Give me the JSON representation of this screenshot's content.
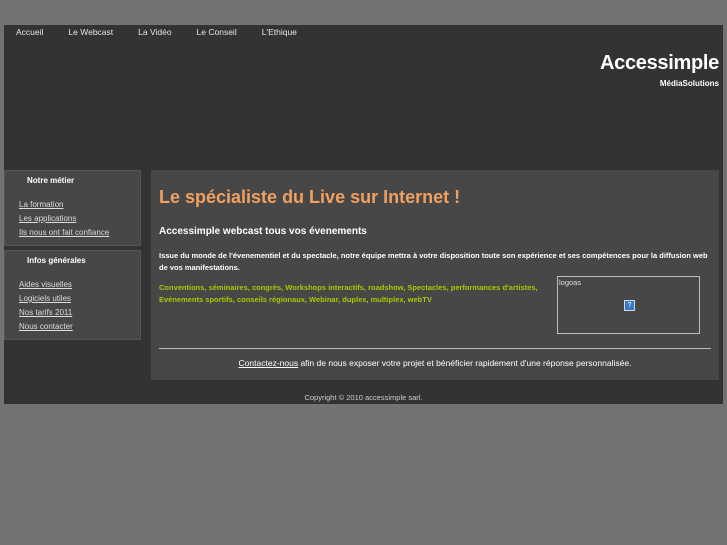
{
  "nav": [
    {
      "label": "Accueil"
    },
    {
      "label": "Le Webcast"
    },
    {
      "label": "La Vidéo"
    },
    {
      "label": "Le Conseil"
    },
    {
      "label": "L'Ethique"
    }
  ],
  "brand": {
    "title": "Accessimple",
    "subtitle": "MédiaSolutions"
  },
  "sidebar": {
    "sections": [
      {
        "title": "Notre métier",
        "items": [
          "La formation",
          "Les applications",
          "Ils nous ont fait confiance"
        ]
      },
      {
        "title": "Infos générales",
        "items": [
          "Aides visuelles",
          "Logiciels utiles",
          "Nos tarifs 2011",
          "Nous contacter"
        ]
      }
    ]
  },
  "main": {
    "headline": "Le spécialiste du Live sur Internet !",
    "subheadline": "Accessimple webcast tous vos évenements",
    "intro": "Issue du monde de l'évenementiel et du spectacle, notre équipe mettra à votre disposition toute son expérience et ses compétences pour la diffusion web de vos manifestations.",
    "events_line1": "Conventions, séminaires, congrès, Workshops interactifs, roadshow, Spectacles, performances d'artistes,",
    "events_line2": "Evénements sportifs, conseils régionaux, Webinar, duplex, multiplex, webTV",
    "logos_label": "logoas",
    "contact_link": "Contactez-nous",
    "contact_text": " afin de nous exposer votre projet et bénéficier rapidement d'une réponse personnalisée."
  },
  "footer": {
    "copyright": "Copyright © 2010 accessimple sarl."
  },
  "colors": {
    "background": "#737373",
    "frame": "#333333",
    "panel": "#474747",
    "headline": "#f0a060",
    "events": "#a8c800"
  }
}
